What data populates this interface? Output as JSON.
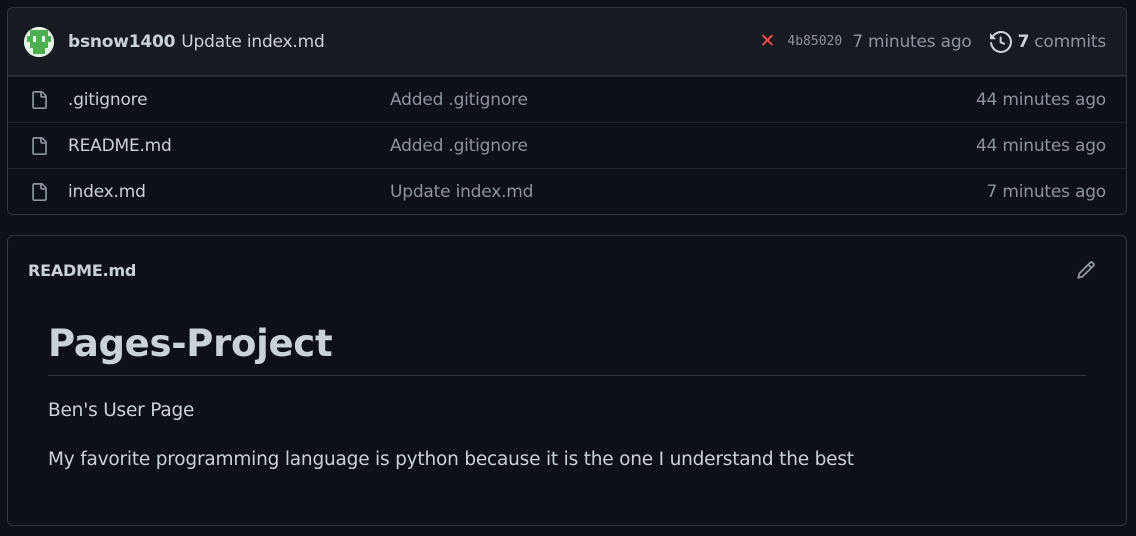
{
  "commit": {
    "author": "bsnow1400",
    "message": "Update index.md",
    "status_icon": "x-icon",
    "status_color": "#f85149",
    "sha": "4b85020",
    "time": "7 minutes ago",
    "commits_count": "7",
    "commits_label": "commits"
  },
  "files": [
    {
      "name": ".gitignore",
      "commit": "Added .gitignore",
      "time": "44 minutes ago"
    },
    {
      "name": "README.md",
      "commit": "Added .gitignore",
      "time": "44 minutes ago"
    },
    {
      "name": "index.md",
      "commit": "Update index.md",
      "time": "7 minutes ago"
    }
  ],
  "readme": {
    "filename": "README.md",
    "heading": "Pages-Project",
    "paragraphs": [
      "Ben's User Page",
      "My favorite programming language is python because it is the one I understand the best"
    ]
  },
  "colors": {
    "background": "#0d1117",
    "header_bg": "#161b22",
    "border": "#30363d",
    "text": "#c9d1d9",
    "muted": "#8b949e",
    "danger": "#f85149"
  }
}
